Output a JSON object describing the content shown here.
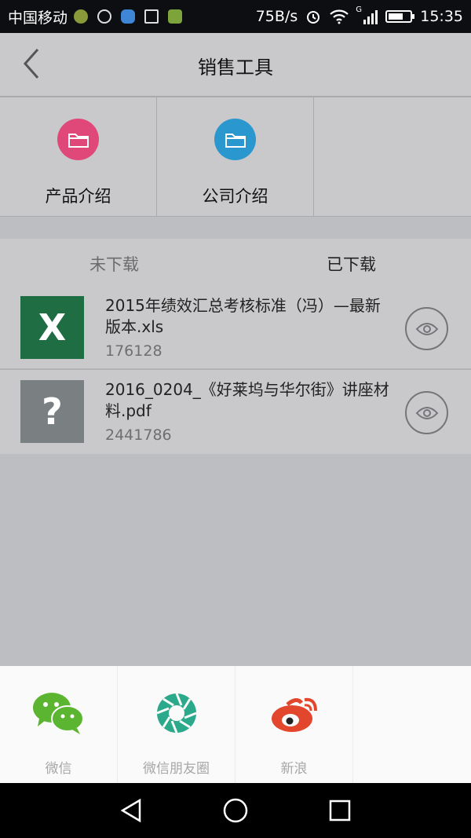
{
  "status_bar": {
    "carrier": "中国移动",
    "net_speed": "75B/s",
    "network_type": "G",
    "time": "15:35",
    "battery_level": 0.7
  },
  "app_bar": {
    "title": "销售工具",
    "back_icon": "chevron-left-icon"
  },
  "categories": [
    {
      "label": "产品介绍",
      "icon": "folder-icon",
      "color": "#e0487a"
    },
    {
      "label": "公司介绍",
      "icon": "folder-icon",
      "color": "#2a97cf"
    }
  ],
  "tabs": [
    {
      "label": "未下载"
    },
    {
      "label": "已下载"
    }
  ],
  "files": [
    {
      "name": "2015年绩效汇总考核标准（冯）—最新版本.xls",
      "size": "176128",
      "thumb_text": "X",
      "thumb_color": "#1f6e43",
      "action_icon": "eye-icon"
    },
    {
      "name": "2016_0204_《好莱坞与华尔街》讲座材料.pdf",
      "size": "2441786",
      "thumb_text": "?",
      "thumb_color": "#7a7f82",
      "action_icon": "eye-icon"
    }
  ],
  "share": [
    {
      "label": "微信",
      "icon": "wechat-icon",
      "color": "#5cb531"
    },
    {
      "label": "微信朋友圈",
      "icon": "moments-icon",
      "color": "#2ba98a"
    },
    {
      "label": "新浪",
      "icon": "weibo-icon",
      "color": "#e2462c"
    }
  ],
  "nav": [
    "back-icon",
    "home-icon",
    "recents-icon"
  ]
}
